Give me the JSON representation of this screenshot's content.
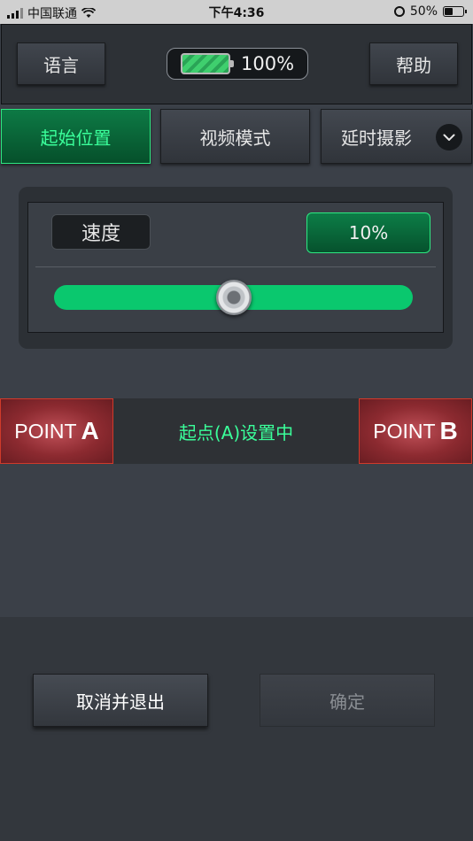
{
  "status_bar": {
    "carrier": "中国联通",
    "time": "下午4:36",
    "battery": "50%"
  },
  "header": {
    "language_label": "语言",
    "help_label": "帮助",
    "battery_level": "100%"
  },
  "tabs": [
    {
      "label": "起始位置",
      "active": true
    },
    {
      "label": "视频模式",
      "active": false
    },
    {
      "label": "延时摄影",
      "active": false
    }
  ],
  "speed": {
    "label": "速度",
    "value": "10%",
    "slider_fraction": 0.5
  },
  "points": {
    "point_a_prefix": "POINT",
    "point_a_letter": "A",
    "status": "起点(A)设置中",
    "point_b_prefix": "POINT",
    "point_b_letter": "B"
  },
  "actions": {
    "cancel_label": "取消并退出",
    "confirm_label": "确定"
  },
  "colors": {
    "accent_green": "#2ee882",
    "point_red": "#d03a2a",
    "slider_green": "#0ac86e"
  }
}
